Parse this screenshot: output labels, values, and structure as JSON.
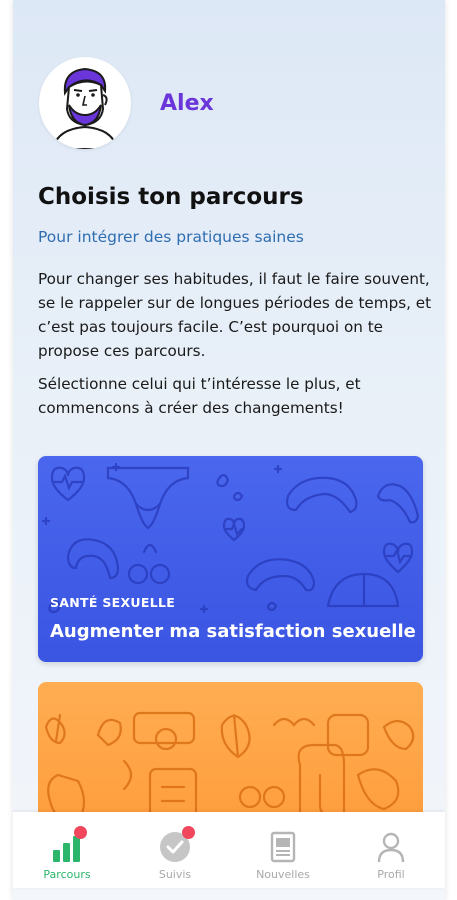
{
  "profile": {
    "name": "Alex"
  },
  "header": {
    "title": "Choisis ton parcours",
    "subtitle": "Pour intégrer des pratiques saines"
  },
  "intro": {
    "p1": "Pour changer ses habitudes, il faut le faire souvent, se le rappeler sur de longues périodes de temps, et c’est pas toujours facile. C’est pourquoi on te propose ces parcours.",
    "p2": "Sélectionne celui qui t’intéresse le plus, et commencons à créer des changements!"
  },
  "cards": [
    {
      "category": "SANTÉ SEXUELLE",
      "title": "Augmenter ma satisfaction sexuelle",
      "color": "#4360eb"
    },
    {
      "category": "",
      "title": "",
      "color": "#ffa445"
    }
  ],
  "tabs": [
    {
      "label": "Parcours",
      "icon": "bar-chart-icon",
      "active": true,
      "badge": true
    },
    {
      "label": "Suivis",
      "icon": "check-circle-icon",
      "active": false,
      "badge": true
    },
    {
      "label": "Nouvelles",
      "icon": "newspaper-icon",
      "active": false,
      "badge": false
    },
    {
      "label": "Profil",
      "icon": "person-icon",
      "active": false,
      "badge": false
    }
  ],
  "colors": {
    "accent": "#6a35d9",
    "subtitle": "#2f6db1",
    "active_tab": "#2cb66b",
    "badge": "#f0475c"
  }
}
